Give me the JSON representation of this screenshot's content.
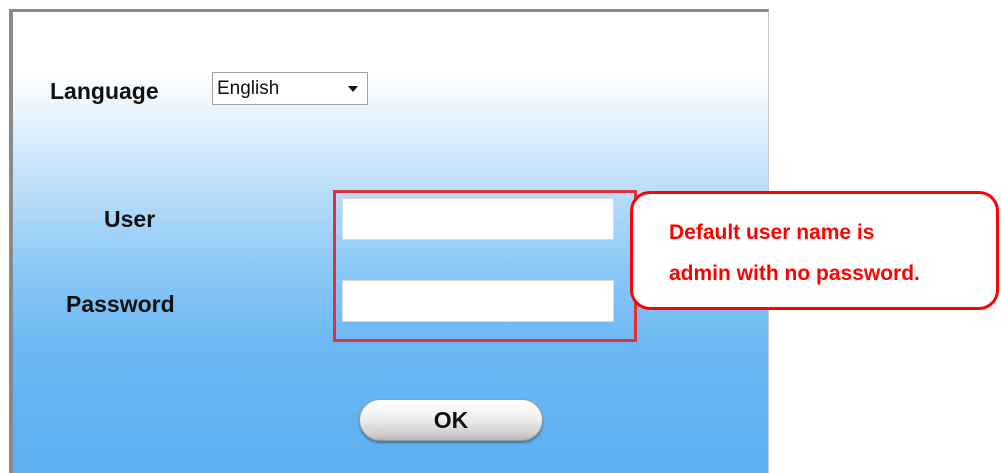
{
  "login": {
    "language_label": "Language",
    "language_selected": "English",
    "user_label": "User",
    "user_value": "",
    "password_label": "Password",
    "password_value": "",
    "ok_label": "OK"
  },
  "callout": {
    "line1": "Default user name is",
    "line2": "admin with no password."
  },
  "colors": {
    "highlight_border": "#e0303a",
    "callout_border": "#ff0000",
    "callout_text": "#ff0000",
    "panel_gradient_top": "#ffffff",
    "panel_gradient_bottom": "#5caff1"
  },
  "icons": {
    "language_dropdown": "chevron-down-icon"
  }
}
